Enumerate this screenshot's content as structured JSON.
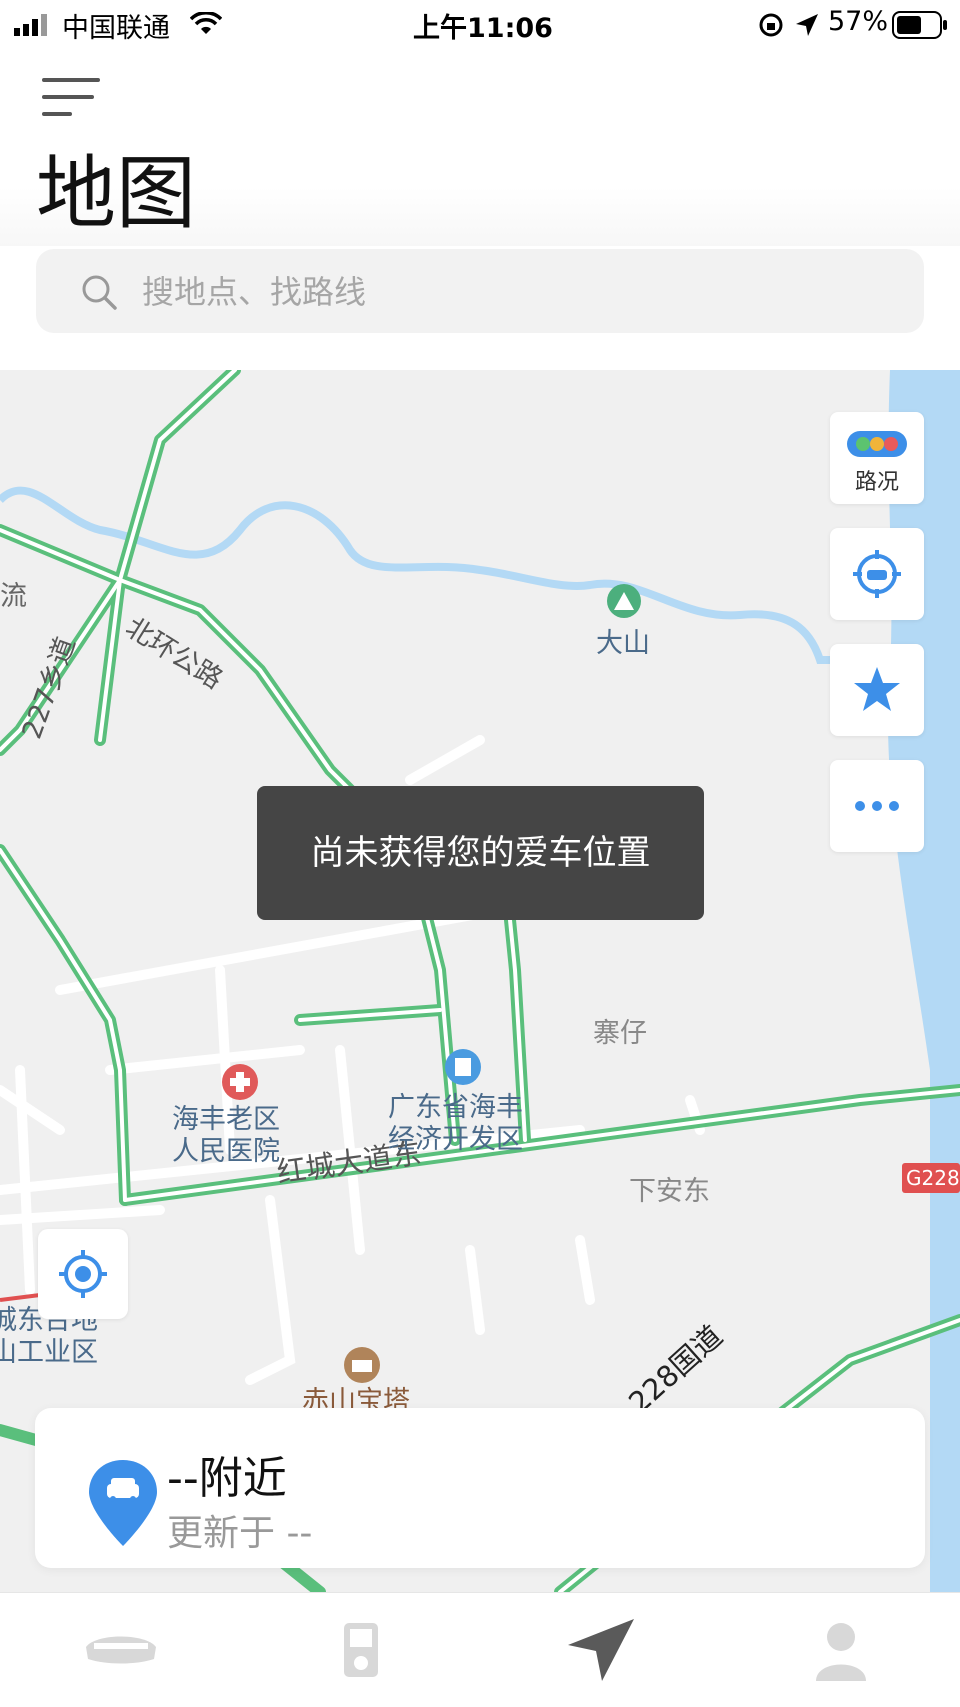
{
  "status_bar": {
    "carrier": "中国联通",
    "time": "上午11:06",
    "battery": "57%"
  },
  "header": {
    "title": "地图"
  },
  "search": {
    "placeholder": "搜地点、找路线"
  },
  "map_controls": {
    "traffic_label": "路况"
  },
  "toast": {
    "message": "尚未获得您的爱车位置"
  },
  "map_labels": {
    "road_north_ring": "北环公路",
    "road_227": "227乡道",
    "road_hongcheng": "红城大道东",
    "road_228": "228国道",
    "road_badge": "G228",
    "place_dashan": "大山",
    "place_zhaizai": "寨仔",
    "place_xiaandong": "下安东",
    "poi_hospital": "海丰老区\n人民医院",
    "poi_devzone": "广东省海丰\n经济开发区",
    "poi_tower": "赤山宝塔",
    "poi_industrial": "城东台地\n山工业区",
    "place_liu": "流"
  },
  "vehicle_card": {
    "location": "--附近",
    "updated": "更新于 --"
  },
  "colors": {
    "road_green": "#5abf7c",
    "water_blue": "#b3d9f5",
    "accent_blue": "#3d8fe8",
    "toast_bg": "#454545"
  },
  "tabs": [
    {
      "name": "car",
      "icon": "car-front-icon"
    },
    {
      "name": "device",
      "icon": "phone-key-icon"
    },
    {
      "name": "map",
      "icon": "navigation-arrow-icon",
      "active": true
    },
    {
      "name": "me",
      "icon": "person-icon"
    }
  ]
}
